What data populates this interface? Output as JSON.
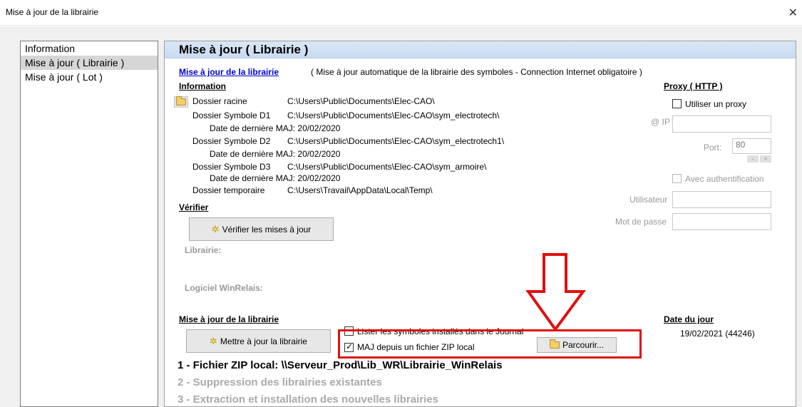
{
  "window": {
    "title": "Mise à jour de la librairie",
    "close_glyph": "✕"
  },
  "nav": {
    "items": [
      {
        "label": "Information",
        "selected": false
      },
      {
        "label": "Mise à jour ( Librairie )",
        "selected": true
      },
      {
        "label": "Mise à jour ( Lot )",
        "selected": false
      }
    ]
  },
  "panel": {
    "title": "Mise à jour ( Librairie )",
    "header_link": "Mise à jour de la librairie",
    "header_note": "( Mise à jour automatique de la librairie des symboles - Connection Internet obligatoire )",
    "information": {
      "heading": "Information",
      "rows": [
        {
          "label": "Dossier racine",
          "value": "C:\\Users\\Public\\Documents\\Elec-CAO\\"
        },
        {
          "label": "Dossier Symbole D1",
          "value": "C:\\Users\\Public\\Documents\\Elec-CAO\\sym_electrotech\\"
        },
        {
          "label": "Date de dernière MAJ: 20/02/2020"
        },
        {
          "label": "Dossier Symbole D2",
          "value": "C:\\Users\\Public\\Documents\\Elec-CAO\\sym_electrotech1\\"
        },
        {
          "label": "Date de dernière MAJ: 20/02/2020"
        },
        {
          "label": "Dossier Symbole D3",
          "value": "C:\\Users\\Public\\Documents\\Elec-CAO\\sym_armoire\\"
        },
        {
          "label": "Date de dernière MAJ: 20/02/2020"
        },
        {
          "label": "Dossier temporaire",
          "value": "C:\\Users\\Travail\\AppData\\Local\\Temp\\"
        }
      ]
    },
    "verifier": {
      "heading": "Vérifier",
      "button": "Vérifier les mises à jour",
      "librairie_label": "Librairie:",
      "logiciel_label": "Logiciel WinRelais:"
    },
    "proxy": {
      "heading": "Proxy ( HTTP )",
      "use_proxy_label": "Utiliser un proxy",
      "ip_label": "@ IP",
      "ip_value": "",
      "port_label": "Port:",
      "port_value": "80",
      "spin_minus": "-",
      "spin_plus": "+",
      "auth_label": "Avec authentification",
      "user_label": "Utilisateur",
      "user_value": "",
      "password_label": "Mot de passe",
      "password_value": ""
    },
    "update": {
      "heading": "Mise à jour de la librairie",
      "button": "Mettre à jour la librairie",
      "list_symbols_label": "Lister les symboles installés dans le Journal",
      "zip_label": "MAJ depuis un fichier ZIP local",
      "browse_button": "Parcourir..."
    },
    "date": {
      "heading": "Date du jour",
      "value": "19/02/2021 (44246)"
    },
    "steps": [
      "1 - Fichier ZIP local: \\\\Serveur_Prod\\Lib_WR\\Librairie_WinRelais",
      "2 - Suppression des librairies existantes",
      "3 - Extraction et installation des nouvelles librairies"
    ],
    "accent_colors": {
      "highlight": "#e01010",
      "link": "#0000cc",
      "header": "#c9dbf1"
    }
  }
}
